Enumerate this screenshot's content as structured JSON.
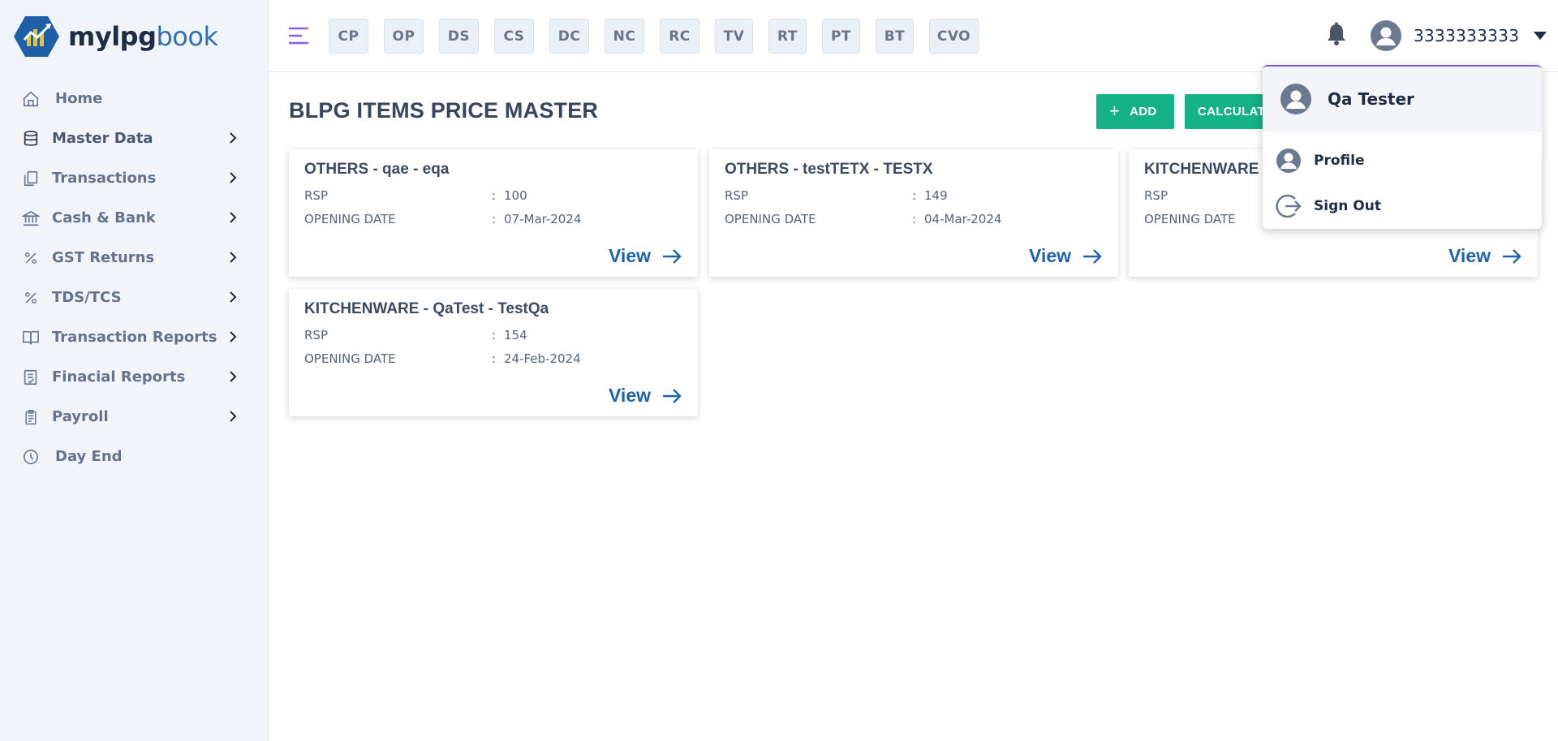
{
  "brand": {
    "part1": "mylpg",
    "part2": "book"
  },
  "sidebar": {
    "items": [
      {
        "label": "Home",
        "icon": "home-icon",
        "has_children": false
      },
      {
        "label": "Master Data",
        "icon": "database-icon",
        "has_children": true
      },
      {
        "label": "Transactions",
        "icon": "documents-icon",
        "has_children": true
      },
      {
        "label": "Cash & Bank",
        "icon": "bank-icon",
        "has_children": true
      },
      {
        "label": "GST Returns",
        "icon": "percent-icon",
        "has_children": true
      },
      {
        "label": "TDS/TCS",
        "icon": "percent-icon",
        "has_children": true
      },
      {
        "label": "Transaction Reports",
        "icon": "book-icon",
        "has_children": true
      },
      {
        "label": "Finacial Reports",
        "icon": "report-icon",
        "has_children": true
      },
      {
        "label": "Payroll",
        "icon": "clipboard-icon",
        "has_children": true
      },
      {
        "label": "Day End",
        "icon": "clock-icon",
        "has_children": false
      }
    ]
  },
  "topbar": {
    "chips": [
      "CP",
      "OP",
      "DS",
      "CS",
      "DC",
      "NC",
      "RC",
      "TV",
      "RT",
      "PT",
      "BT",
      "CVO"
    ],
    "user_id": "3333333333"
  },
  "page": {
    "title": "BLPG ITEMS PRICE MASTER",
    "add_label": "ADD",
    "calc_label": "CALCULATE"
  },
  "cards": [
    {
      "title": "OTHERS - qae - eqa",
      "rsp_label": "RSP",
      "rsp": "100",
      "date_label": "OPENING DATE",
      "date": "07-Mar-2024",
      "view": "View"
    },
    {
      "title": "OTHERS - testTETX - TESTX",
      "rsp_label": "RSP",
      "rsp": "149",
      "date_label": "OPENING DATE",
      "date": "04-Mar-2024",
      "view": "View"
    },
    {
      "title": "KITCHENWARE -",
      "rsp_label": "RSP",
      "rsp": "",
      "date_label": "OPENING DATE",
      "date": "",
      "view": "View"
    },
    {
      "title": "KITCHENWARE - QaTest - TestQa",
      "rsp_label": "RSP",
      "rsp": "154",
      "date_label": "OPENING DATE",
      "date": "24-Feb-2024",
      "view": "View"
    }
  ],
  "dropdown": {
    "name": "Qa Tester",
    "items": [
      {
        "label": "Profile",
        "icon": "user-circle-icon"
      },
      {
        "label": "Sign Out",
        "icon": "sign-out-icon"
      }
    ]
  },
  "colors": {
    "accent": "#15b285",
    "link": "#1f63a8",
    "sidebar_bg": "#f1f4f9",
    "hamburger": "#8b5cf6"
  }
}
